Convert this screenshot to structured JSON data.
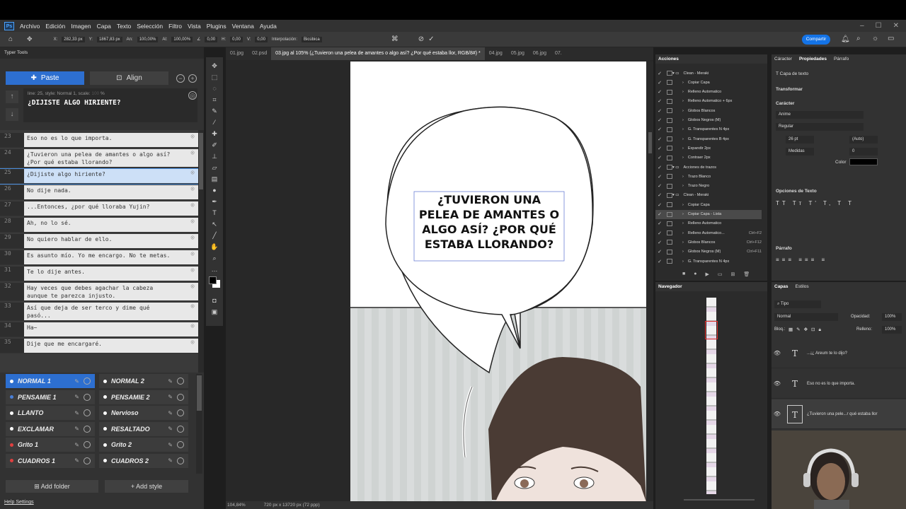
{
  "menu": [
    "Archivo",
    "Edición",
    "Imagen",
    "Capa",
    "Texto",
    "Selección",
    "Filtro",
    "Vista",
    "Plugins",
    "Ventana",
    "Ayuda"
  ],
  "options": {
    "x": "282,33 px",
    "y": "1867,83 px",
    "an": "100,00%",
    "al": "100,00%",
    "angle": "0,00",
    "h": "0,00",
    "v": "0,00",
    "interp_label": "Interpolación:",
    "interp": "Bicúbica",
    "share": "Compartir"
  },
  "left": {
    "title": "Typer Tools",
    "paste": "Paste",
    "align": "Align",
    "meta": "line: 25, style: Normal 1, scale:",
    "scale_pct": "%",
    "current": "¿DIJISTE ALGO HIRIENTE?",
    "lines": [
      {
        "n": "23",
        "t": "Eso no es lo que importa."
      },
      {
        "n": "24",
        "t": "¿Tuvieron una pelea de amantes o algo así?\n¿Por qué estaba llorando?"
      },
      {
        "n": "25",
        "t": "¿Dijiste algo hiriente?"
      },
      {
        "n": "26",
        "t": "No dije nada."
      },
      {
        "n": "27",
        "t": "...Entonces, ¿por qué lloraba Yujin?"
      },
      {
        "n": "28",
        "t": "Ah, no lo sé."
      },
      {
        "n": "29",
        "t": "No quiero hablar de ello."
      },
      {
        "n": "30",
        "t": "Es asunto mío. Yo me encargo. No te metas."
      },
      {
        "n": "31",
        "t": "Te lo dije antes."
      },
      {
        "n": "32",
        "t": "Hay veces que debes agachar la cabeza\naunque te parezca injusto."
      },
      {
        "n": "33",
        "t": "Así que deja de ser terco y dime qué\npasó..."
      },
      {
        "n": "34",
        "t": "Ha~"
      },
      {
        "n": "35",
        "t": "Dije que me encargaré."
      }
    ],
    "styles": [
      "NORMAL 1",
      "NORMAL 2",
      "PENSAMIE 1",
      "PENSAMIE 2",
      "LLANTO",
      "Nervioso",
      "EXCLAMAR",
      "RESALTADO",
      "Grito 1",
      "Grito 2",
      "CUADROS 1",
      "CUADROS 2"
    ],
    "add_folder": "Add folder",
    "add_style": "Add style",
    "help": "Help",
    "settings": "Settings"
  },
  "tabs": [
    "01.jpg",
    "02.psd",
    "03.jpg al 105% (¿Tuvieron una pelea de amantes o algo así? ¿Por qué estaba llor, RGB/8#) *",
    "04.jpg",
    "05.jpg",
    "06.jpg",
    "07."
  ],
  "canvas": {
    "bubble_text": [
      "¿TUVIERON UNA",
      "PELEA DE AMANTES O",
      "ALGO ASÍ? ¿POR QUÉ",
      "ESTABA LLORANDO?"
    ]
  },
  "status": {
    "zoom": "104,84%",
    "size": "720 px x 13720 px (72 ppp)"
  },
  "actions": {
    "title": "Acciones",
    "rows": [
      {
        "l": "Clean - Meraki",
        "f": true
      },
      {
        "l": "Copiar Capa"
      },
      {
        "l": "Relleno Automatico"
      },
      {
        "l": "Relleno Automatico + 6px"
      },
      {
        "l": "Globos Blancos"
      },
      {
        "l": "Globos Negros (M)"
      },
      {
        "l": "G. Transparentes N 4px"
      },
      {
        "l": "G. Transparentes B 4px"
      },
      {
        "l": "Expandir 2px"
      },
      {
        "l": "Contraer 2px"
      },
      {
        "l": "Acciones de trazos",
        "f": true
      },
      {
        "l": "Trazo Blanco"
      },
      {
        "l": "Trazo Negro"
      },
      {
        "l": "Clean - Meraki",
        "f": true
      },
      {
        "l": "Copiar Capa"
      },
      {
        "l": "Copiar Capa - Lista"
      },
      {
        "l": "Relleno Automatico"
      },
      {
        "l": "Relleno Automatico...",
        "s": "Ctrl+F2"
      },
      {
        "l": "Globos Blancos",
        "s": "Ctrl+F12"
      },
      {
        "l": "Globos Negros (M)",
        "s": "Ctrl+F11"
      },
      {
        "l": "G. Transparentes N 4px"
      }
    ]
  },
  "navigator": {
    "title": "Navegador"
  },
  "props": {
    "tabs": [
      "Cáracter",
      "Propiedades",
      "Párrafo"
    ],
    "layer": "Capa de texto",
    "transform": "Transformar",
    "caracter": "Carácter",
    "font": "Anime",
    "style": "Regular",
    "size": "26 pt",
    "leading": "(Auto)",
    "kern": "Medidas",
    "track": "0",
    "color_label": "Color",
    "text_options": "Opciones de Texto",
    "parrafo": "Párrafo"
  },
  "layers": {
    "tabs": [
      "Capas",
      "Estilos"
    ],
    "filter": "Tipo",
    "blend": "Normal",
    "opacity_label": "Opacidad:",
    "opacity": "100%",
    "lock": "Bloq.:",
    "fill_label": "Relleno:",
    "fill": "100%",
    "items": [
      "...¡¿ Areum te lo dijo?",
      "Eso no es lo que importa.",
      "¿Tuvieron una pele...r qué estaba llor"
    ]
  }
}
